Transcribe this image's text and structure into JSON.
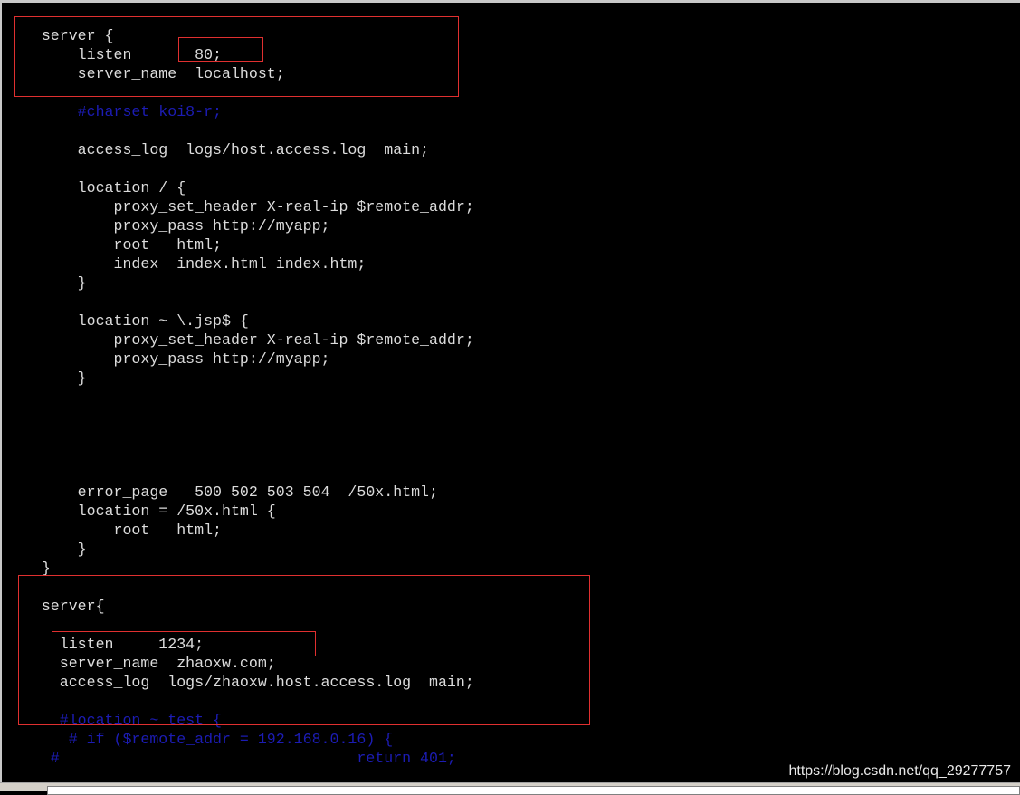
{
  "terminal": {
    "lines": [
      {
        "text": "    server {",
        "type": "code"
      },
      {
        "text": "        listen       80;",
        "type": "code"
      },
      {
        "text": "        server_name  localhost;",
        "type": "code"
      },
      {
        "text": "",
        "type": "code"
      },
      {
        "text": "        #charset koi8-r;",
        "type": "comment"
      },
      {
        "text": "",
        "type": "code"
      },
      {
        "text": "        access_log  logs/host.access.log  main;",
        "type": "code"
      },
      {
        "text": "",
        "type": "code"
      },
      {
        "text": "        location / {",
        "type": "code"
      },
      {
        "text": "            proxy_set_header X-real-ip $remote_addr;",
        "type": "code"
      },
      {
        "text": "            proxy_pass http://myapp;",
        "type": "code"
      },
      {
        "text": "            root   html;",
        "type": "code"
      },
      {
        "text": "            index  index.html index.htm;",
        "type": "code"
      },
      {
        "text": "        }",
        "type": "code"
      },
      {
        "text": "",
        "type": "code"
      },
      {
        "text": "        location ~ \\.jsp$ {",
        "type": "code"
      },
      {
        "text": "            proxy_set_header X-real-ip $remote_addr;",
        "type": "code"
      },
      {
        "text": "            proxy_pass http://myapp;",
        "type": "code"
      },
      {
        "text": "        }",
        "type": "code"
      },
      {
        "text": "",
        "type": "code"
      },
      {
        "text": "",
        "type": "code"
      },
      {
        "text": "",
        "type": "code"
      },
      {
        "text": "",
        "type": "code"
      },
      {
        "text": "",
        "type": "code"
      },
      {
        "text": "        error_page   500 502 503 504  /50x.html;",
        "type": "code"
      },
      {
        "text": "        location = /50x.html {",
        "type": "code"
      },
      {
        "text": "            root   html;",
        "type": "code"
      },
      {
        "text": "        }",
        "type": "code"
      },
      {
        "text": "    }",
        "type": "code"
      },
      {
        "text": "",
        "type": "code"
      },
      {
        "text": "    server{",
        "type": "code"
      },
      {
        "text": "",
        "type": "code"
      },
      {
        "text": "      listen     1234;",
        "type": "code"
      },
      {
        "text": "      server_name  zhaoxw.com;",
        "type": "code"
      },
      {
        "text": "      access_log  logs/zhaoxw.host.access.log  main;",
        "type": "code"
      },
      {
        "text": "",
        "type": "code"
      },
      {
        "text": "      #location ~ test {",
        "type": "comment"
      },
      {
        "text": "       # if ($remote_addr = 192.168.0.16) {",
        "type": "comment"
      },
      {
        "text": "     #                                 return 401;",
        "type": "comment"
      }
    ]
  },
  "watermark": "https://blog.csdn.net/qq_29277757",
  "colors": {
    "text": "#dcdcdc",
    "comment": "#1c1cb4",
    "highlight_box": "#e03030",
    "background": "#000000"
  }
}
